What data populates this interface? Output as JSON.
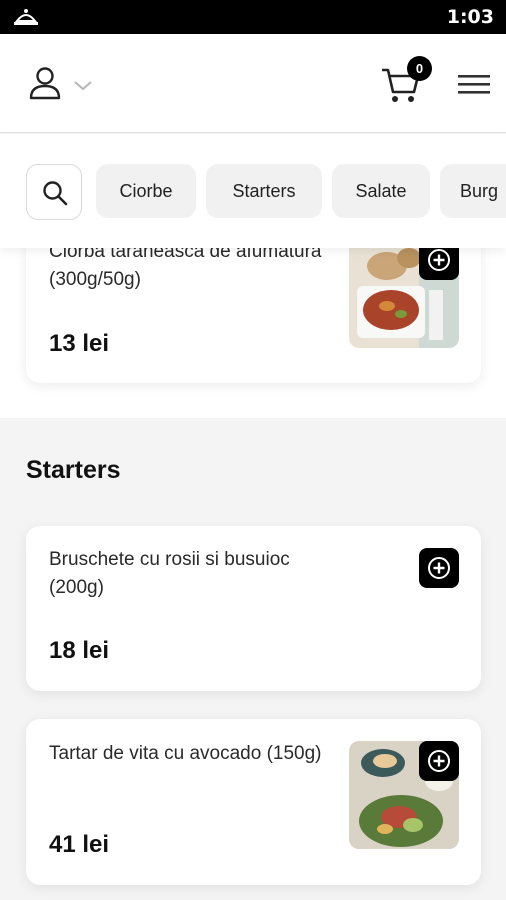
{
  "status_bar": {
    "time": "1:03"
  },
  "header": {
    "cart_count": "0"
  },
  "categories": {
    "items": [
      {
        "label": "Ciorbe"
      },
      {
        "label": "Starters"
      },
      {
        "label": "Salate"
      },
      {
        "label": "Burg"
      }
    ]
  },
  "menu": {
    "first_item": {
      "name": "Ciorba taraneasca de afumatura (300g/50g)",
      "price": "13 lei"
    },
    "starters": {
      "title": "Starters",
      "items": [
        {
          "name": "Bruschete cu rosii si busuioc (200g)",
          "price": "18 lei"
        },
        {
          "name": "Tartar de vita cu avocado (150g)",
          "price": "41 lei"
        }
      ]
    }
  }
}
